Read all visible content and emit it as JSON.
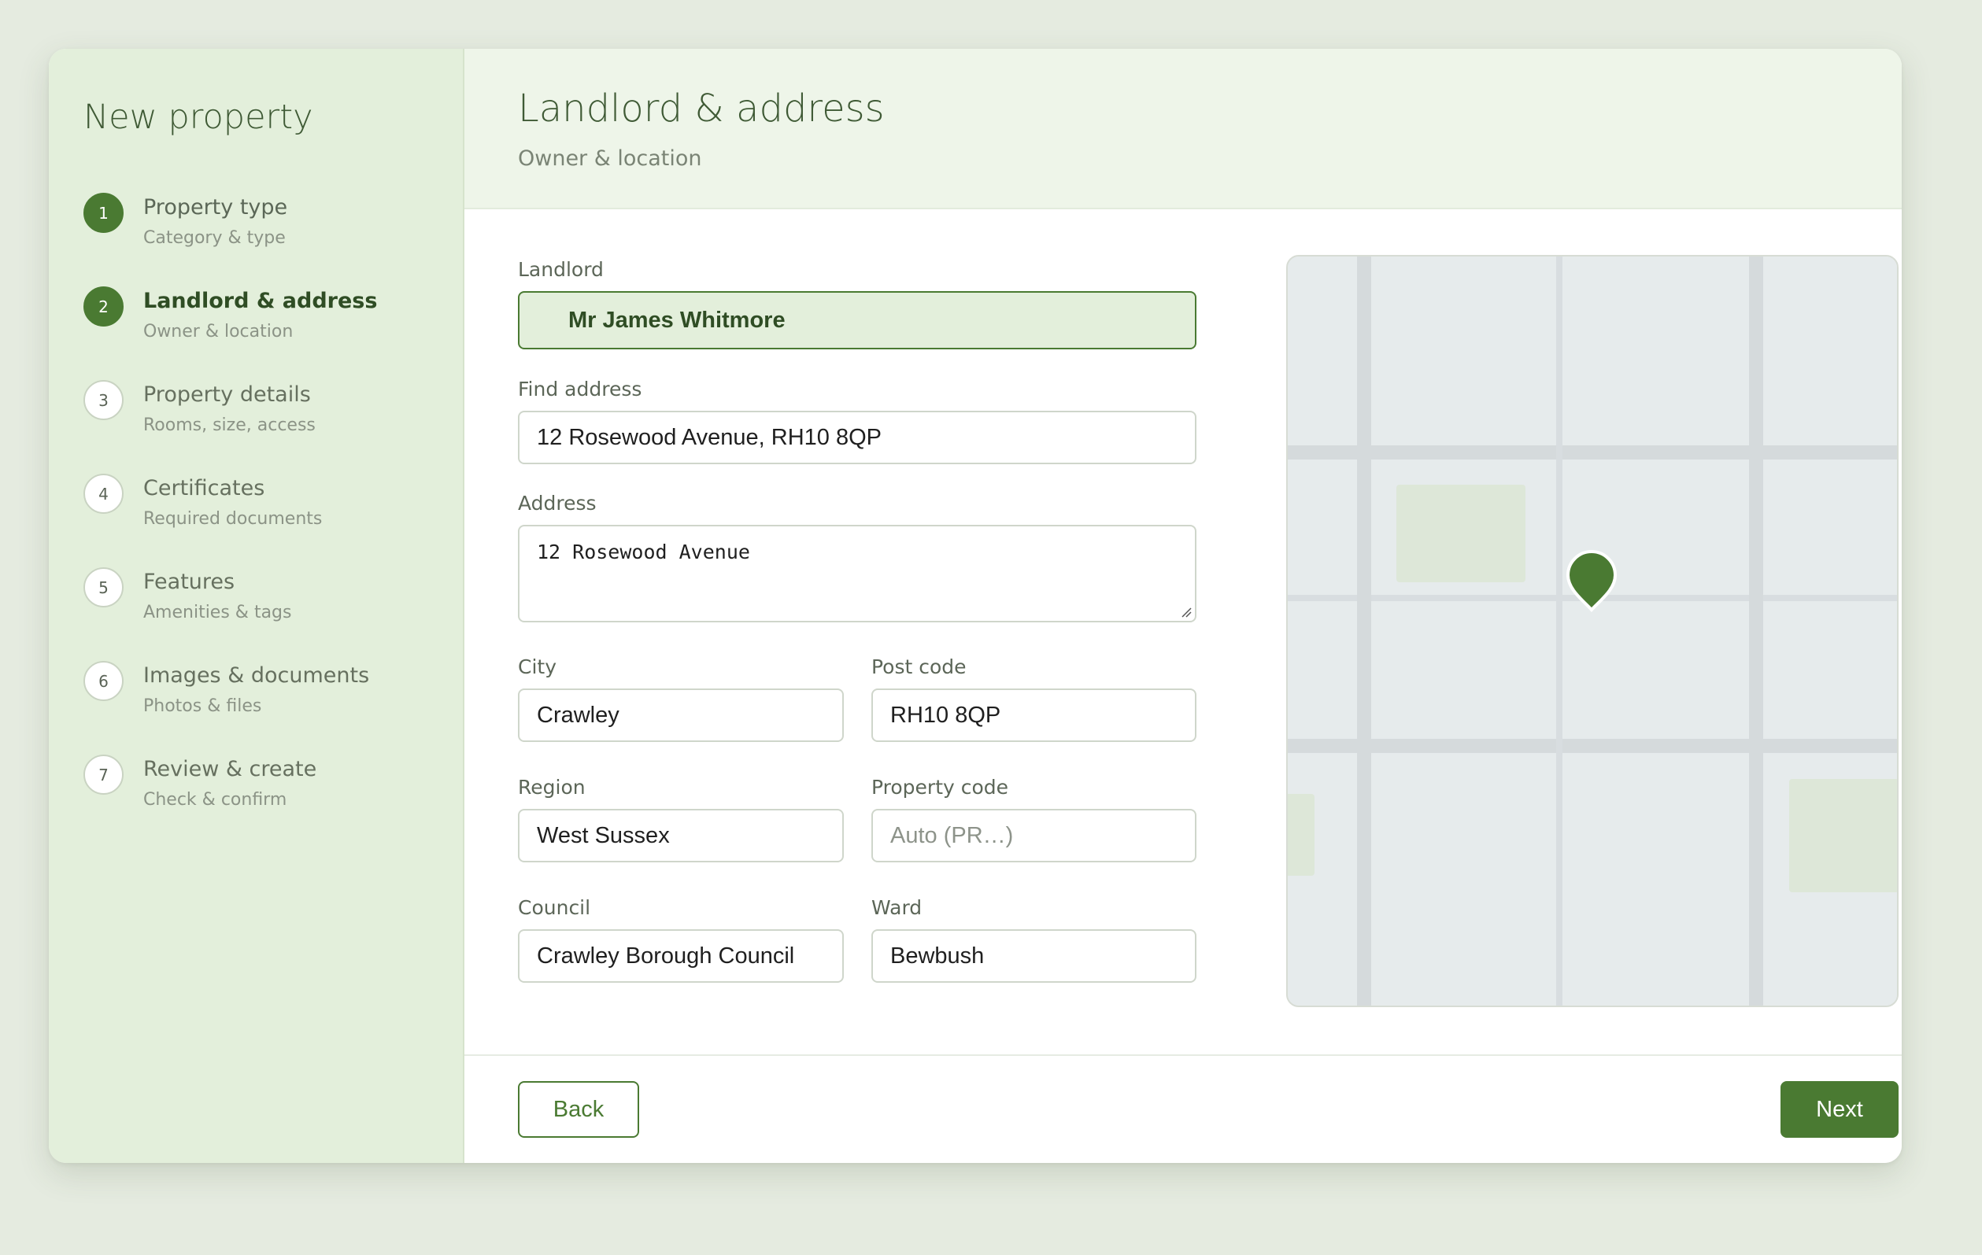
{
  "sidebar": {
    "title": "New property",
    "steps": [
      {
        "num": "1",
        "title": "Property type",
        "sub": "Category & type"
      },
      {
        "num": "2",
        "title": "Landlord & address",
        "sub": "Owner & location"
      },
      {
        "num": "3",
        "title": "Property details",
        "sub": "Rooms, size, access"
      },
      {
        "num": "4",
        "title": "Certificates",
        "sub": "Required documents"
      },
      {
        "num": "5",
        "title": "Features",
        "sub": "Amenities & tags"
      },
      {
        "num": "6",
        "title": "Images & documents",
        "sub": "Photos & files"
      },
      {
        "num": "7",
        "title": "Review & create",
        "sub": "Check & confirm"
      }
    ]
  },
  "header": {
    "title": "Landlord & address",
    "subtitle": "Owner & location"
  },
  "form": {
    "landlord": {
      "label": "Landlord",
      "value": "Mr James Whitmore"
    },
    "find_address": {
      "label": "Find address",
      "value": "12 Rosewood Avenue, RH10 8QP"
    },
    "address": {
      "label": "Address",
      "value": "12 Rosewood Avenue"
    },
    "city": {
      "label": "City",
      "value": "Crawley"
    },
    "post_code": {
      "label": "Post code",
      "value": "RH10 8QP"
    },
    "region": {
      "label": "Region",
      "value": "West Sussex"
    },
    "property_code": {
      "label": "Property code",
      "placeholder": "Auto (PR…)"
    },
    "council": {
      "label": "Council",
      "value": "Crawley Borough Council"
    },
    "ward": {
      "label": "Ward",
      "value": "Bewbush"
    }
  },
  "footer": {
    "back_label": "Back",
    "next_label": "Next"
  },
  "colors": {
    "accent": "#4a7a32",
    "sidebar_bg": "#e3efdb",
    "header_bg": "#eef5e9",
    "map_bg": "#e6ebec"
  }
}
